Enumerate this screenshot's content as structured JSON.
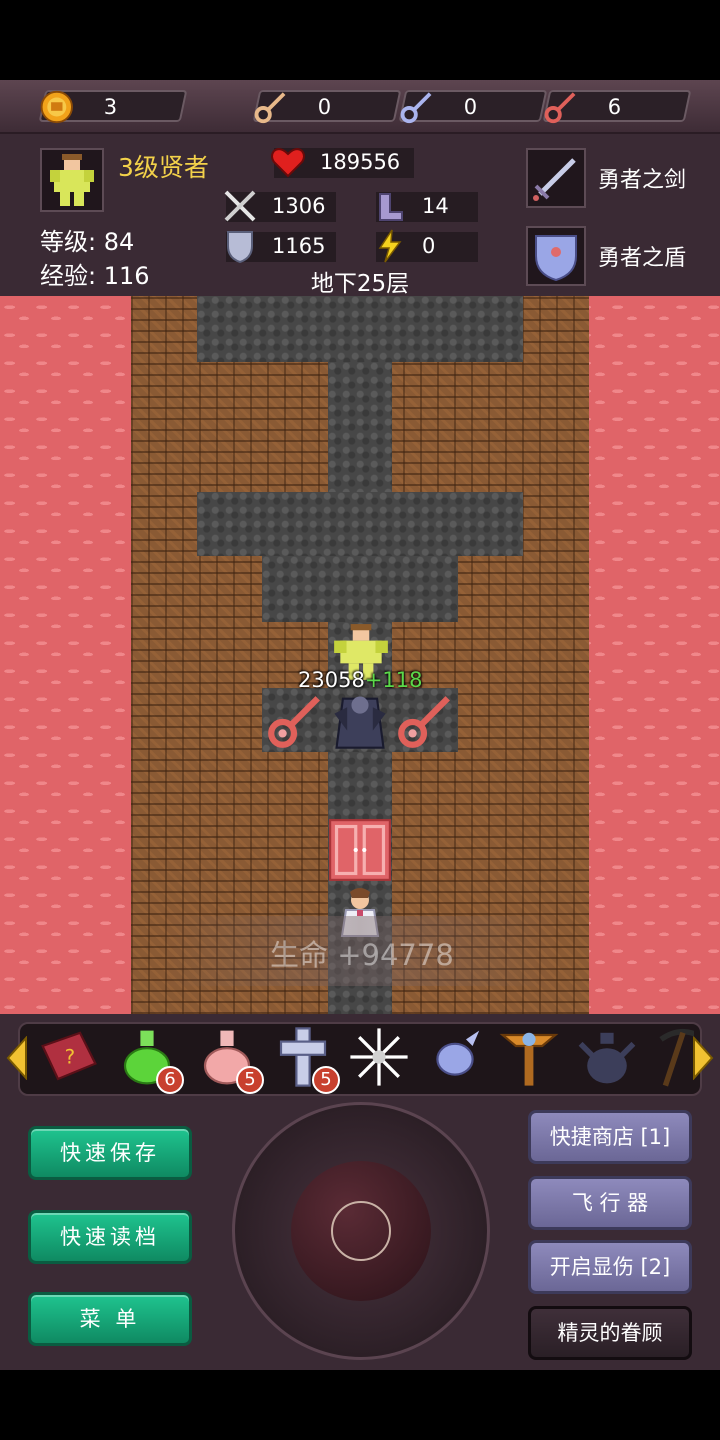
{
  "resources": {
    "coins": "3",
    "yellow_keys": "0",
    "blue_keys": "0",
    "red_keys": "6"
  },
  "hero": {
    "title": "3级贤者",
    "level_label": "等级:",
    "level": "84",
    "exp_label": "经验:",
    "exp": "116",
    "hp": "189556",
    "attack": "1306",
    "defense": "1165",
    "agility": "14",
    "magic": "0",
    "floor": "地下25层",
    "weapon": "勇者之剑",
    "shield": "勇者之盾"
  },
  "map": {
    "damage": "23058",
    "damage_gain": "+118",
    "toast": "生命 +94778"
  },
  "items": {
    "green_potion_count": "6",
    "pink_potion_count": "5",
    "cross_count": "5"
  },
  "buttons": {
    "quick_save": "快速保存",
    "quick_load": "快速读档",
    "menu": "菜 单",
    "quick_shop": "快捷商店 [1]",
    "flyer": "飞 行 器",
    "show_damage": "开启显伤 [2]",
    "fairy_favor": "精灵的眷顾"
  },
  "colors": {
    "gold": "#f3d24a",
    "green_button": "#1fc48f",
    "purple_button": "#8e8abc",
    "lava": "#e06468",
    "key_red": "#e0605a"
  },
  "icons": [
    "coin-icon",
    "yellow-key-icon",
    "blue-key-icon",
    "red-key-icon",
    "heart-icon",
    "sword-icon",
    "boots-icon",
    "shield-icon",
    "lightning-icon",
    "monster-book-icon",
    "green-potion-icon",
    "pink-potion-icon",
    "holy-cross-icon",
    "snowflake-icon",
    "orb-icon",
    "staff-icon",
    "dark-vase-icon",
    "pickaxe-icon"
  ]
}
